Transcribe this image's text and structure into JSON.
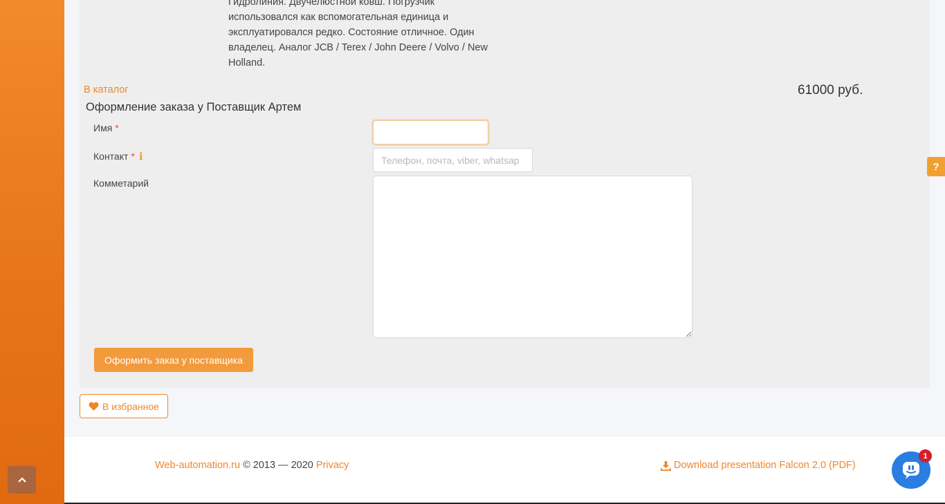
{
  "product": {
    "description_lines": [
      "Гидролиния. Двучелюстной ковш. Погрузчик",
      "использовался как вспомогательная единица и",
      "эксплуатировался редко. Состояние отличное. Один",
      "владелец. Аналог JCB / Terex / John Deere / Volvo / New",
      "Holland."
    ],
    "catalog_link": "В каталог",
    "price": "61000 руб."
  },
  "order_form": {
    "title": "Оформление заказа у Поставщик Артем",
    "name_label": "Имя",
    "name_value": "",
    "contact_label": "Контакт",
    "contact_placeholder": "Телефон, почта, viber, whatsap",
    "contact_value": "",
    "comment_label": "Комметарий",
    "comment_value": "",
    "required_mark": "*",
    "info_mark": "ℹ",
    "submit_label": "Оформить заказ у поставщика"
  },
  "favorite": {
    "label": "В избранное",
    "icon": "heart-icon"
  },
  "help_tab": {
    "label": "?"
  },
  "footer": {
    "site_link": "Web-automation.ru",
    "copyright": " © 2013 — 2020 ",
    "privacy_link": "Privacy",
    "download_link": "Download presentation Falcon 2.0 (PDF)"
  },
  "chat": {
    "badge_count": "1"
  },
  "colors": {
    "accent": "#f0862a",
    "button": "#f39a3c",
    "chat": "#2a7de1",
    "sidebar": "#e8751a"
  }
}
